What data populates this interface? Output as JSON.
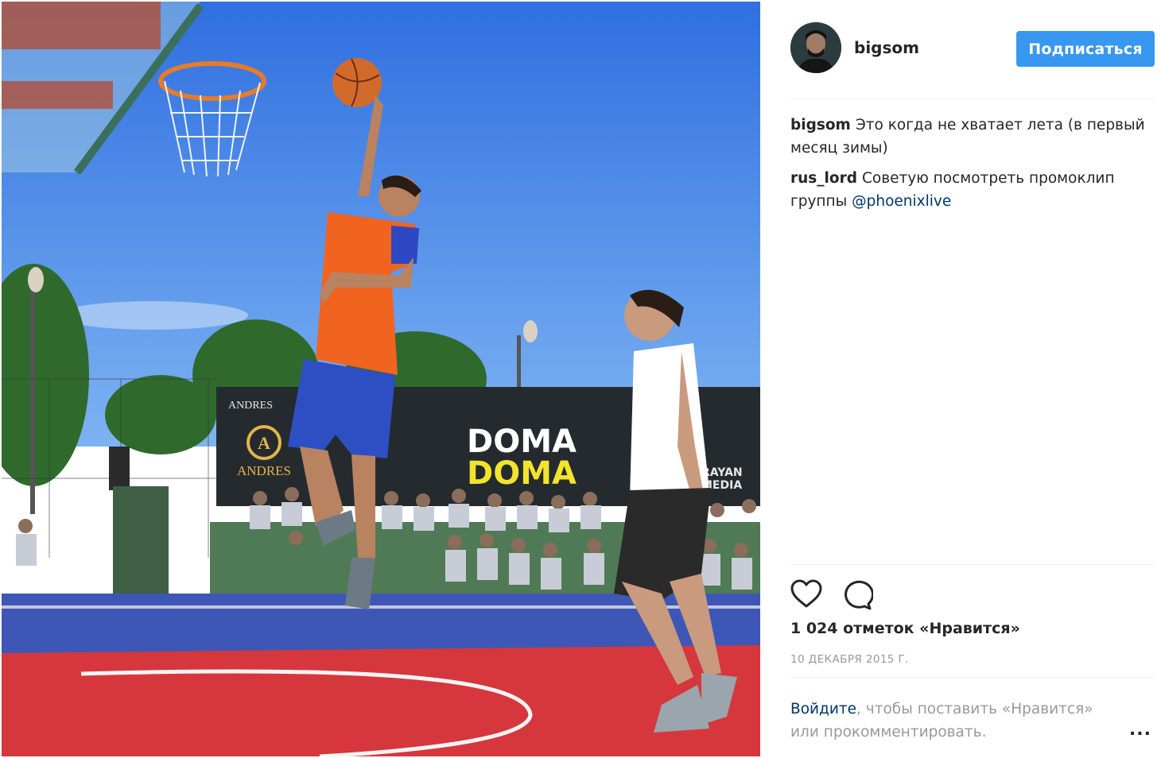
{
  "post": {
    "username": "bigsom",
    "follow_label": "Подписаться",
    "photo_icon": "basketball-streetball-photo",
    "banner": {
      "andres_top": "ANDRES",
      "andres_logo": "ANDRES",
      "doma_line1": "DOMA",
      "doma_line2": "DOMA",
      "rayan_line1": "RAYAN",
      "rayan_line2": "MEDIA"
    }
  },
  "comments": [
    {
      "author": "bigsom",
      "text": "Это когда не хватает лета (в первый месяц зимы)"
    },
    {
      "author": "rus_lord",
      "text": "Советую посмотреть промоклип группы",
      "mention": "@phoenixlive"
    }
  ],
  "actions": {
    "like_icon": "heart-icon",
    "comment_icon": "comment-bubble-icon"
  },
  "likes_text": "1 024 отметок «Нравится»",
  "date_text": "10 ДЕКАБРЯ 2015 Г.",
  "login_prompt": {
    "link": "Войдите",
    "rest": ", чтобы поставить «Нравится» или прокомментировать."
  },
  "more_label": "...",
  "colors": {
    "accent": "#3897f0",
    "link": "#003569",
    "muted": "#999999"
  }
}
